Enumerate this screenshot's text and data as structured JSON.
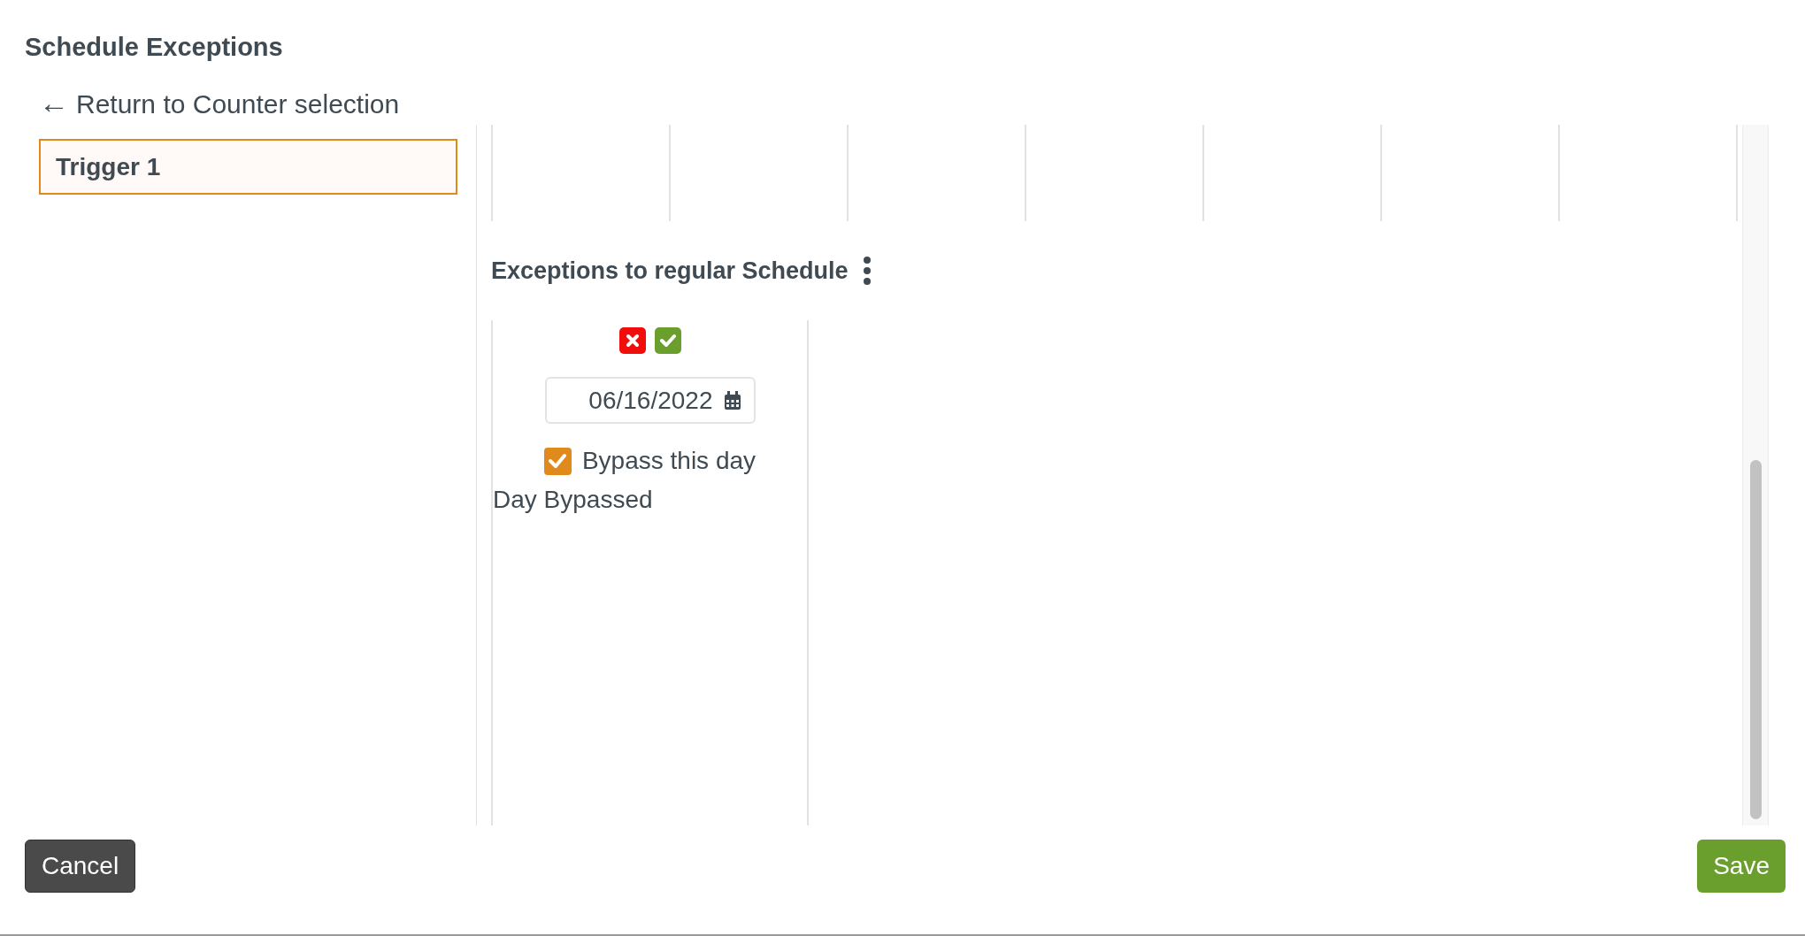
{
  "title": "Schedule Exceptions",
  "back_link": {
    "icon": "←",
    "label": "Return to Counter selection"
  },
  "triggers": [
    {
      "label": "Trigger 1",
      "selected": true
    }
  ],
  "exceptions": {
    "heading": "Exceptions to regular Schedule",
    "items": [
      {
        "date": "06/16/2022",
        "bypass": {
          "label": "Bypass this day",
          "checked": true
        },
        "status": "Day Bypassed"
      }
    ]
  },
  "buttons": {
    "cancel": "Cancel",
    "save": "Save"
  }
}
